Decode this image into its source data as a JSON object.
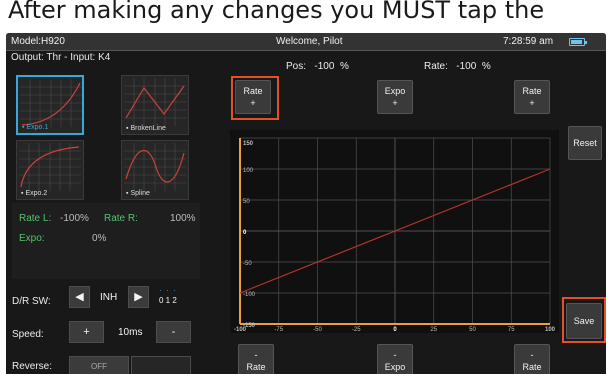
{
  "caption": "After making any changes you MUST tap the",
  "status": {
    "model": "Model:H920",
    "welcome": "Welcome, Pilot",
    "time": "7:28:59 am"
  },
  "output_header": "Output: Thr - Input: K4",
  "curves": [
    {
      "label": "Expo.1",
      "selected": true
    },
    {
      "label": "BrokenLine",
      "selected": false
    },
    {
      "label": "Expo.2",
      "selected": false
    },
    {
      "label": "Spline",
      "selected": false
    }
  ],
  "info": {
    "rate_l_label": "Rate L:",
    "rate_l_value": "-100%",
    "rate_r_label": "Rate R:",
    "rate_r_value": "100%",
    "expo_label": "Expo:",
    "expo_value": "0%"
  },
  "dr": {
    "label": "D/R SW:",
    "prev": "◀",
    "value": "INH",
    "next": "▶",
    "positions": "0 1 2"
  },
  "speed": {
    "label": "Speed:",
    "plus": "+",
    "value": "10ms",
    "minus": "-"
  },
  "reverse": {
    "label": "Reverse:",
    "value": "OFF"
  },
  "pos": {
    "label": "Pos:",
    "value": "-100",
    "unit": "%"
  },
  "rate": {
    "label": "Rate:",
    "value": "-100",
    "unit": "%"
  },
  "buttons": {
    "rate_plus_left": [
      "Rate",
      "+"
    ],
    "expo_plus": [
      "Expo",
      "+"
    ],
    "rate_plus_right": [
      "Rate",
      "+"
    ],
    "reset": "Reset",
    "save": "Save",
    "rate_minus_left": [
      "-",
      "Rate"
    ],
    "expo_minus": [
      "-",
      "Expo"
    ],
    "rate_minus_right": [
      "-",
      "Rate"
    ]
  },
  "colors": {
    "highlight": "#e2502a",
    "accent": "#3aa7d9",
    "green_text": "#52c46b",
    "curve": "#b2322f",
    "axis_orange": "#e8a13c"
  },
  "chart_data": {
    "type": "line",
    "x_ticks": [
      -100,
      -75,
      -50,
      -25,
      0,
      25,
      50,
      75,
      100
    ],
    "y_ticks": [
      150,
      100,
      50,
      0,
      -50,
      -100,
      -150
    ],
    "xlim": [
      -100,
      100
    ],
    "ylim": [
      -150,
      150
    ],
    "grid": true,
    "series": [
      {
        "x": [
          -100,
          100
        ],
        "y": [
          -100,
          100
        ]
      }
    ]
  }
}
